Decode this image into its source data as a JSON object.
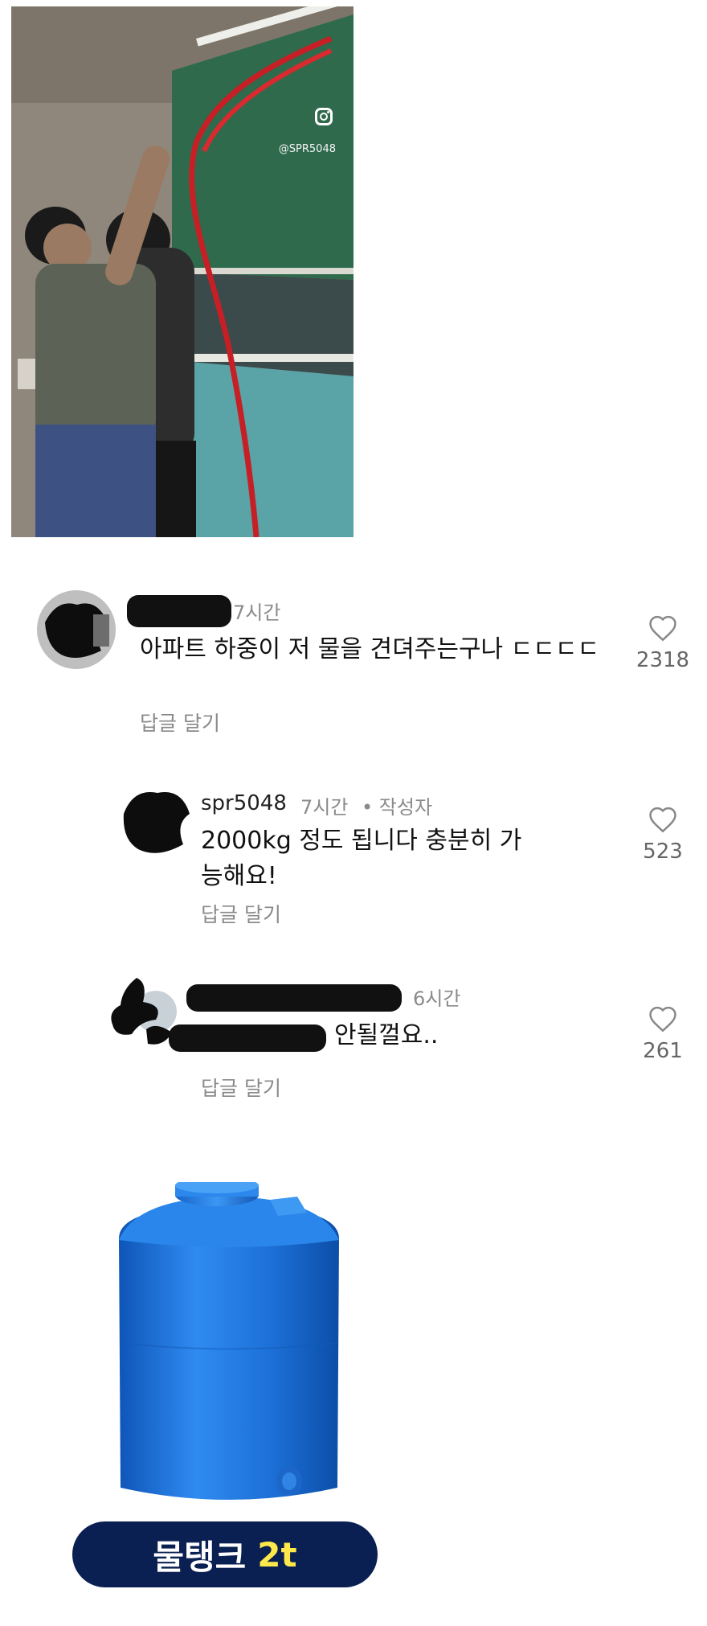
{
  "photo": {
    "watermark": "@SPR5048",
    "icon": "instagram-icon"
  },
  "comments": [
    {
      "time": "7시간",
      "text": "아파트 하중이 저 물을 견뎌주는구나 ㄷㄷㄷㄷ",
      "reply_label": "답글 달기",
      "likes": "2318"
    },
    {
      "username": "spr5048",
      "time": "7시간",
      "author_badge": "작성자",
      "text": "2000kg 정도 됩니다 충분히 가능해요!",
      "reply_label": "답글 달기",
      "likes": "523"
    },
    {
      "time": "6시간",
      "text": "안될껄요..",
      "reply_label": "답글 달기",
      "likes": "261"
    }
  ],
  "tank": {
    "label_white": "물탱크",
    "label_yellow": "2t",
    "colors": {
      "tank": "#1c6fd6",
      "badge_bg": "#0b2052",
      "badge_highlight": "#ffe84a"
    }
  }
}
